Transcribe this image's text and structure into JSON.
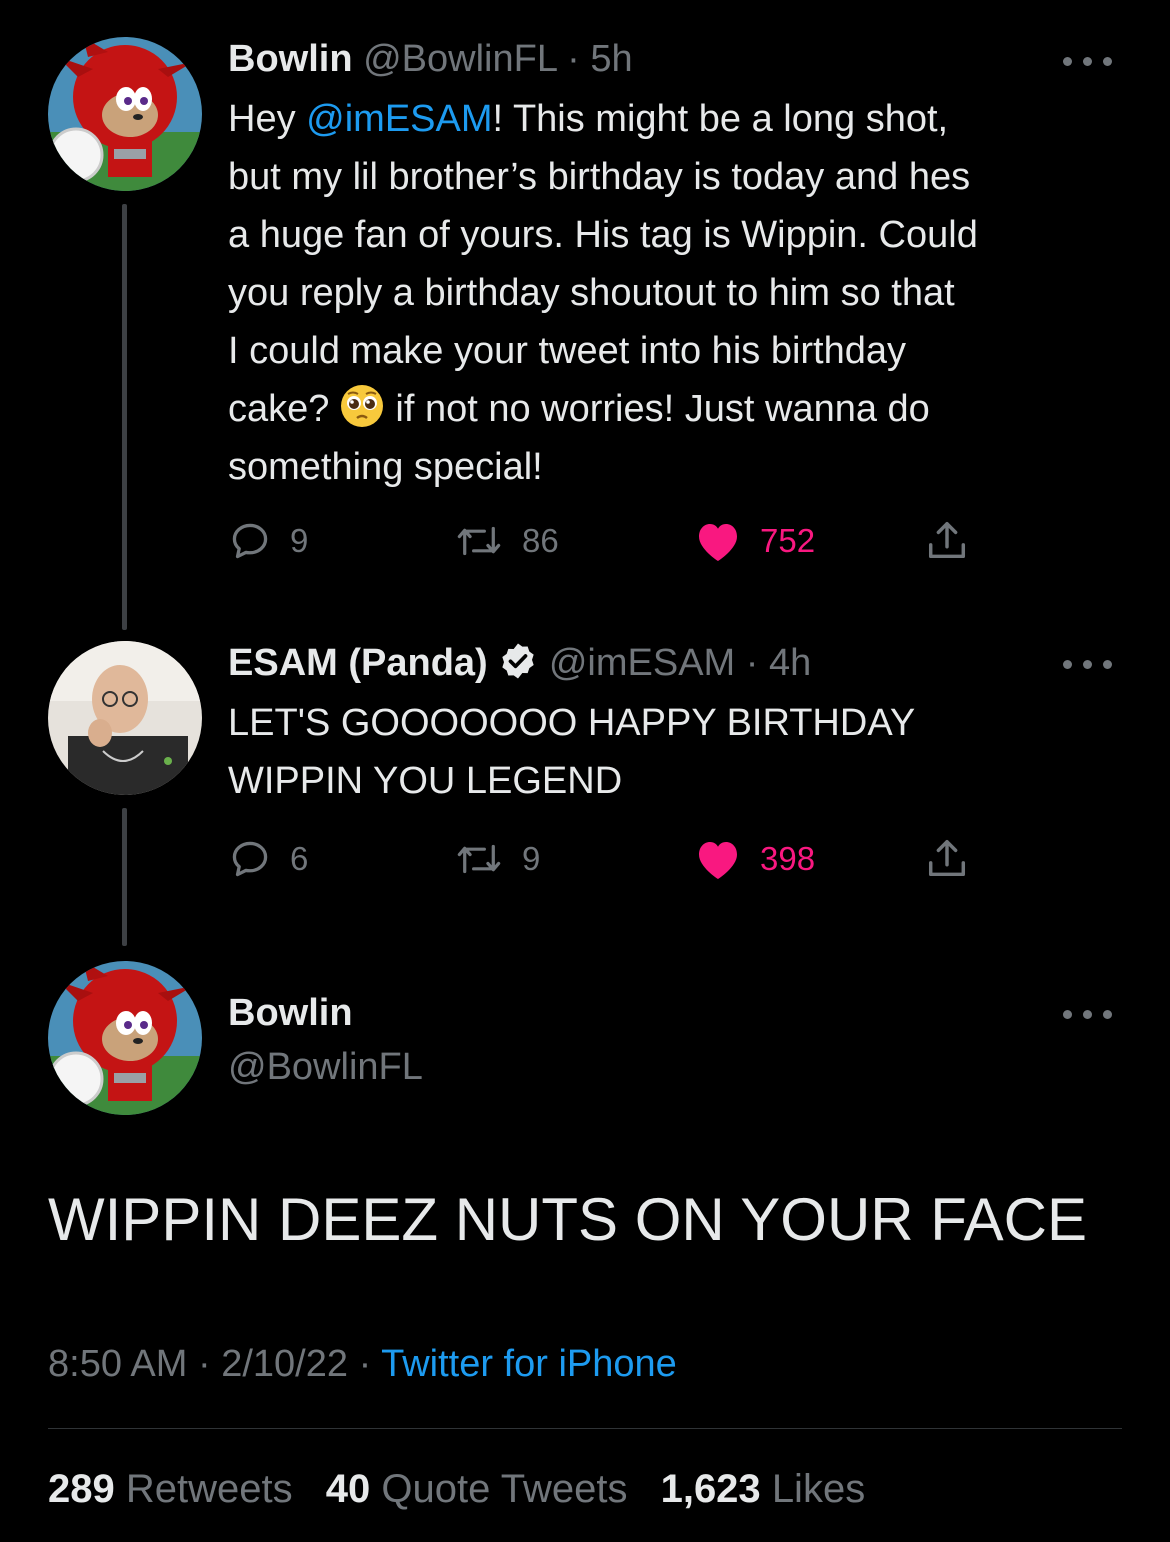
{
  "tweets": [
    {
      "name": "Bowlin",
      "handle": "@BowlinFL",
      "separator": "·",
      "time": "5h",
      "text_lines": [
        [
          "Hey ",
          "@imESAM",
          "! This might be a long shot,"
        ],
        "but my lil brother’s birthday is today and hes",
        "a huge fan of yours. His tag is Wippin. Could",
        "you reply a birthday shoutout to him so that",
        "I could make your tweet into his birthday",
        [
          "cake?",
          "if not no worries! Just wanna do"
        ],
        "something special!"
      ],
      "emoji": "pleading-face",
      "replies": "9",
      "retweets": "86",
      "likes": "752",
      "liked": true
    },
    {
      "name": "ESAM (Panda)",
      "verified": true,
      "handle": "@imESAM",
      "separator": "·",
      "time": "4h",
      "text_lines": [
        "LET'S GOOOOOOO HAPPY BIRTHDAY",
        "WIPPIN YOU LEGEND"
      ],
      "replies": "6",
      "retweets": "9",
      "likes": "398",
      "liked": true
    }
  ],
  "main_tweet": {
    "name": "Bowlin",
    "handle": "@BowlinFL",
    "text": "WIPPIN DEEZ NUTS ON YOUR FACE",
    "time": "8:50 AM",
    "date": "2/10/22",
    "separator": "·",
    "source": "Twitter for iPhone",
    "stats": {
      "retweets_count": "289",
      "retweets_label": "Retweets",
      "quotes_count": "40",
      "quotes_label": "Quote Tweets",
      "likes_count": "1,623",
      "likes_label": "Likes"
    }
  },
  "colors": {
    "background": "#000000",
    "text": "#e7e9ea",
    "secondary": "#71767b",
    "link": "#1d9bf0",
    "like": "#f91880",
    "verified_badge": "#e7e9ea"
  }
}
